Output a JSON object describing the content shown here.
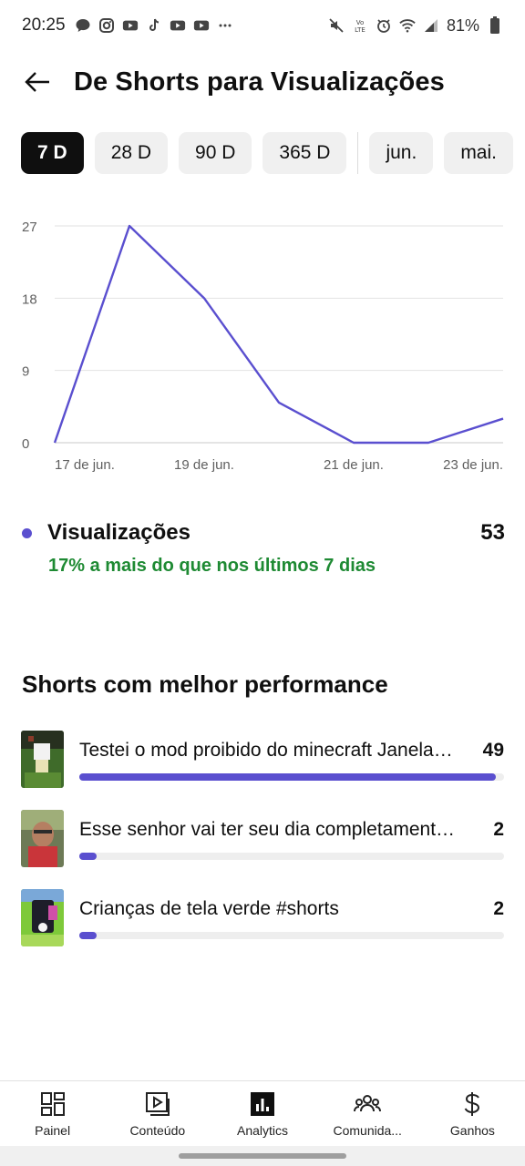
{
  "status": {
    "time": "20:25",
    "battery": "81%",
    "left_icons": [
      "chat-bubble-icon",
      "instagram-icon",
      "youtube-icon",
      "tiktok-icon",
      "youtube-icon",
      "youtube-icon",
      "more-dots-icon"
    ],
    "right_icons": [
      "mute-icon",
      "volte-icon",
      "alarm-icon",
      "wifi-icon",
      "signal-icon",
      "battery-icon"
    ]
  },
  "header": {
    "title": "De Shorts para Visualizações",
    "back_icon": "arrow-left-icon"
  },
  "chips": [
    "7 D",
    "28 D",
    "90 D",
    "365 D",
    "jun.",
    "mai."
  ],
  "selected_chip": "7 D",
  "chart_data": {
    "type": "line",
    "x": [
      "17 de jun.",
      "18 de jun.",
      "19 de jun.",
      "20 de jun.",
      "21 de jun.",
      "22 de jun.",
      "23 de jun."
    ],
    "x_tick_labels": [
      "17 de jun.",
      "19 de jun.",
      "21 de jun.",
      "23 de jun."
    ],
    "series": [
      {
        "values": [
          0,
          27,
          18,
          5,
          0,
          0,
          3
        ]
      }
    ],
    "y_ticks": [
      "0",
      "9",
      "18",
      "27"
    ],
    "ylim": [
      0,
      27
    ],
    "grid": true,
    "line_color": "#5a4fcf"
  },
  "legend": {
    "label": "Visualizações",
    "value": "53",
    "comparison": "17% a mais do que nos últimos 7 dias",
    "dot_color": "#5a4fcf",
    "comparison_color": "#1e8a33"
  },
  "top_shorts": {
    "title": "Shorts com melhor performance",
    "items": [
      {
        "title": "Testei o mod proibido do minecraft Janela do mal #shorts",
        "count": "49",
        "fraction": 0.98
      },
      {
        "title": "Esse senhor vai ter seu dia completamente destruído #shorts",
        "count": "2",
        "fraction": 0.04
      },
      {
        "title": "Crianças de tela verde #shorts",
        "count": "2",
        "fraction": 0.04
      }
    ]
  },
  "bottom_nav": [
    {
      "label": "Painel",
      "icon": "dashboard-icon"
    },
    {
      "label": "Conteúdo",
      "icon": "content-icon"
    },
    {
      "label": "Analytics",
      "icon": "analytics-icon"
    },
    {
      "label": "Comunida...",
      "icon": "community-icon"
    },
    {
      "label": "Ganhos",
      "icon": "dollar-icon"
    }
  ]
}
